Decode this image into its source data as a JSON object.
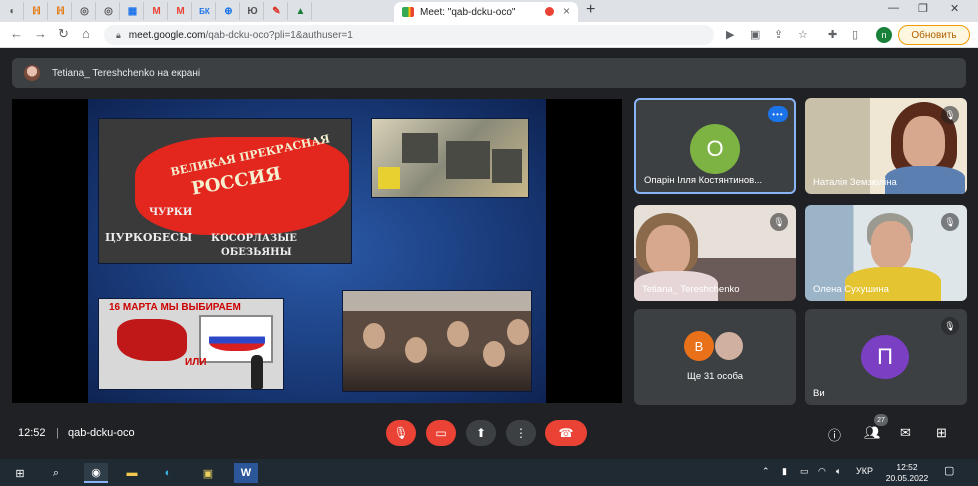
{
  "browser": {
    "active_tab_title": "Meet: \"qab-dcku-oco\"",
    "url_host": "meet.google.com",
    "url_path": "/qab-dcku-oco?pli=1&authuser=1",
    "profile_initial": "n",
    "update_label": "Обновить",
    "pinned_tabs": [
      "globe",
      "bookmark",
      "bookmark",
      "opera",
      "opera",
      "calendar",
      "gmail",
      "M",
      "БК",
      "globe",
      "Ю",
      "pen",
      "drive"
    ]
  },
  "meet": {
    "presenter_banner": "Tetiana_ Tereshchenko на екрані",
    "slide": {
      "map_title_line1": "ВЕЛИКАЯ ПРЕКРАСНАЯ",
      "map_title_line2": "РОССИЯ",
      "map_words": [
        "ЧУРКИ",
        "ЦУРКОБЕСЫ",
        "КОСОРЛАЗЫЕ",
        "ОБЕЗЬЯНЫ"
      ],
      "poster_heading": "16 МАРТА МЫ ВЫБИРАЕМ",
      "poster_or": "ИЛИ"
    },
    "tiles": [
      {
        "name": "Опарін Ілля Костянтинов...",
        "initial": "О",
        "muted": false,
        "speaking": true
      },
      {
        "name": "Наталія Земзюліна",
        "muted": true
      },
      {
        "name": "Tetiana_ Tereshchenko",
        "muted": true
      },
      {
        "name": "Олена Сухушина",
        "muted": true
      },
      {
        "name": "Ще 31 особа",
        "avatar_initial": "В"
      },
      {
        "name": "Ви",
        "initial": "П",
        "muted": true
      }
    ],
    "time": "12:52",
    "separator": "|",
    "meeting_code": "qab-dcku-oco",
    "participants_count": "27"
  },
  "taskbar": {
    "lang": "УКР",
    "clock_time": "12:52",
    "clock_date": "20.05.2022"
  },
  "colors": {
    "accent": "#1a73e8",
    "danger": "#ea4335",
    "panel": "#3c4043",
    "bg": "#202124"
  }
}
